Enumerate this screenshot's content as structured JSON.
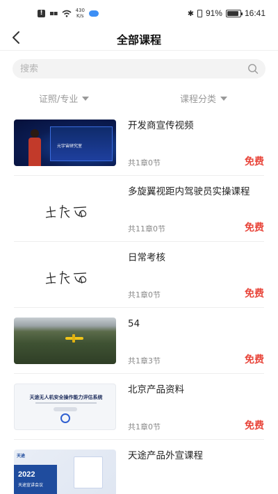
{
  "status_bar": {
    "net_speed_value": "430",
    "net_speed_unit": "K/s",
    "battery": "91%",
    "time": "16:41",
    "battery_level": 0.91
  },
  "header": {
    "title": "全部课程",
    "back_icon": "chevron-left-icon"
  },
  "search": {
    "placeholder": "搜索",
    "icon": "search-icon"
  },
  "filters": {
    "left": "证照/专业",
    "right": "课程分类"
  },
  "courses": [
    {
      "title": "开发商宣传视频",
      "meta": "共1章0节",
      "price": "免费",
      "thumb_kind": "video",
      "thumb_text": "元宇宙研究室"
    },
    {
      "title": "多旋翼视距内驾驶员实操课程",
      "meta": "共11章0节",
      "price": "免费",
      "thumb_kind": "signature"
    },
    {
      "title": "日常考核",
      "meta": "共1章0节",
      "price": "免费",
      "thumb_kind": "signature"
    },
    {
      "title": "54",
      "meta": "共1章3节",
      "price": "免费",
      "thumb_kind": "aerial"
    },
    {
      "title": "北京产品资料",
      "meta": "共1章0节",
      "price": "免费",
      "thumb_kind": "document",
      "thumb_text": "天途无人机安全操作能力评估系统"
    },
    {
      "title": "天途产品外宣课程",
      "meta": "",
      "price": "",
      "thumb_kind": "conference",
      "thumb_year": "2022",
      "thumb_text": "天途宣讲会议",
      "thumb_brand": "天途"
    }
  ],
  "colors": {
    "price": "#e8453a",
    "muted": "#999999",
    "search_bg": "#f3f3f3"
  }
}
